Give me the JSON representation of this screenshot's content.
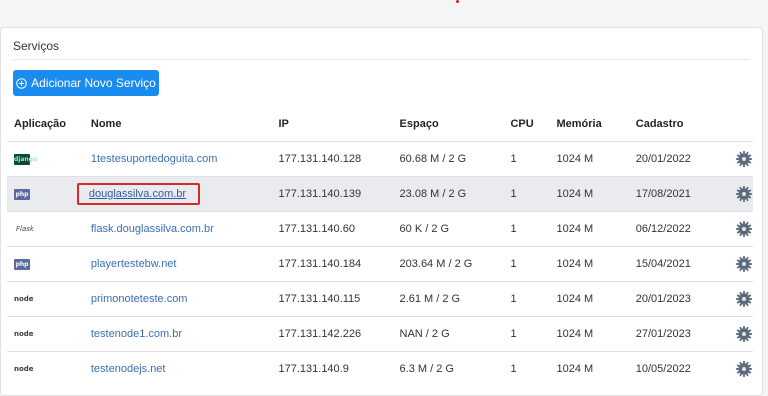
{
  "card": {
    "title": "Serviços",
    "add_button_label": "Adicionar Novo Serviço"
  },
  "table": {
    "headers": {
      "app": "Aplicação",
      "name": "Nome",
      "ip": "IP",
      "space": "Espaço",
      "cpu": "CPU",
      "memory": "Memória",
      "date": "Cadastro"
    },
    "rows": [
      {
        "app": "django",
        "app_label": "django",
        "name": "1testesuportedoguita.com",
        "ip": "177.131.140.128",
        "space": "60.68 M / 2 G",
        "cpu": "1",
        "memory": "1024 M",
        "date": "20/01/2022"
      },
      {
        "app": "php",
        "app_label": "php",
        "name": "douglassilva.com.br",
        "ip": "177.131.140.139",
        "space": "23.08 M / 2 G",
        "cpu": "1",
        "memory": "1024 M",
        "date": "17/08/2021",
        "selected": true
      },
      {
        "app": "flask",
        "app_label": "Flask",
        "name": "flask.douglassilva.com.br",
        "ip": "177.131.140.60",
        "space": "60 K / 2 G",
        "cpu": "1",
        "memory": "1024 M",
        "date": "06/12/2022"
      },
      {
        "app": "php",
        "app_label": "php",
        "name": "playertestebw.net",
        "ip": "177.131.140.184",
        "space": "203.64 M / 2 G",
        "cpu": "1",
        "memory": "1024 M",
        "date": "15/04/2021"
      },
      {
        "app": "node",
        "app_label": "node",
        "name": "primonoteteste.com",
        "ip": "177.131.140.115",
        "space": "2.61 M / 2 G",
        "cpu": "1",
        "memory": "1024 M",
        "date": "20/01/2023"
      },
      {
        "app": "node",
        "app_label": "node",
        "name": "testenode1.com.br",
        "ip": "177.131.142.226",
        "space": "NAN / 2 G",
        "cpu": "1",
        "memory": "1024 M",
        "date": "27/01/2023"
      },
      {
        "app": "node",
        "app_label": "node",
        "name": "testenodejs.net",
        "ip": "177.131.140.9",
        "space": "6.3 M / 2 G",
        "cpu": "1",
        "memory": "1024 M",
        "date": "10/05/2022"
      }
    ]
  },
  "colors": {
    "primary_button": "#1a8cf0",
    "link": "#3b6fb6",
    "highlight_border": "#d42a2a",
    "gear": "#5b6b7c"
  }
}
